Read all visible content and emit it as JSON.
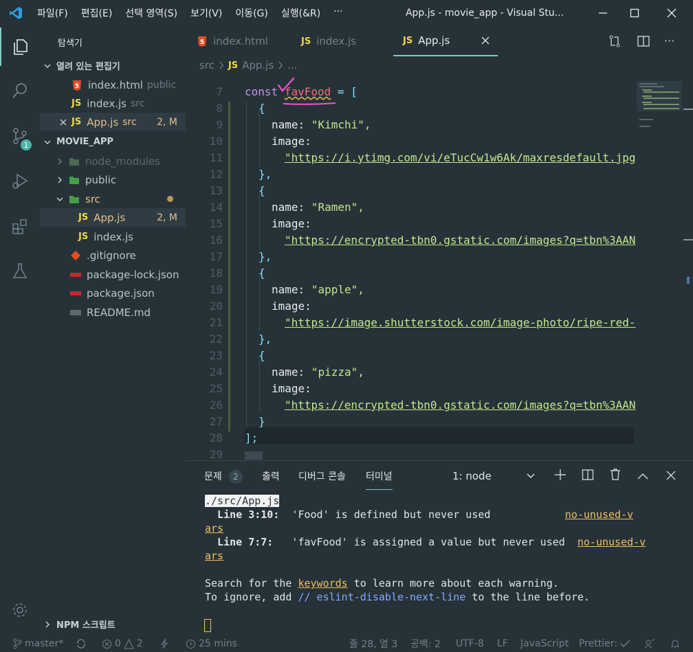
{
  "menu": {
    "items": [
      "파일(F)",
      "편집(E)",
      "선택 영역(S)",
      "보기(V)",
      "이동(G)",
      "실행(&R)",
      "···"
    ]
  },
  "window_title": "App.js - movie_app - Visual Stu...",
  "activity": {
    "scm_badge": "1"
  },
  "sidebar": {
    "title": "탐색기",
    "open_editors": {
      "title": "열려 있는 편집기",
      "files": [
        {
          "name": "index.html",
          "folder": "public"
        },
        {
          "name": "index.js",
          "folder": "src"
        },
        {
          "name": "App.js",
          "folder": "src",
          "status": "2, M"
        }
      ]
    },
    "project": {
      "title": "MOVIE_APP",
      "items": [
        {
          "name": "node_modules"
        },
        {
          "name": "public"
        },
        {
          "name": "src"
        },
        {
          "name": "App.js",
          "status": "2, M"
        },
        {
          "name": "index.js"
        },
        {
          "name": ".gitignore"
        },
        {
          "name": "package-lock.json"
        },
        {
          "name": "package.json"
        },
        {
          "name": "README.md"
        }
      ]
    },
    "npm_title": "NPM 스크립트"
  },
  "tabs": [
    {
      "label": "index.html"
    },
    {
      "label": "index.js"
    },
    {
      "label": "App.js"
    }
  ],
  "breadcrumb": {
    "folder": "src",
    "file": "App.js",
    "more": "..."
  },
  "editor": {
    "lines": [
      {
        "n": "7"
      },
      {
        "n": "8"
      },
      {
        "n": "9"
      },
      {
        "n": "10"
      },
      {
        "n": "11"
      },
      {
        "n": "12"
      },
      {
        "n": "13"
      },
      {
        "n": "14"
      },
      {
        "n": "15"
      },
      {
        "n": "16"
      },
      {
        "n": "17"
      },
      {
        "n": "18"
      },
      {
        "n": "19"
      },
      {
        "n": "20"
      },
      {
        "n": "21"
      },
      {
        "n": "22"
      },
      {
        "n": "23"
      },
      {
        "n": "24"
      },
      {
        "n": "25"
      },
      {
        "n": "26"
      },
      {
        "n": "27"
      },
      {
        "n": "28"
      },
      {
        "n": "29"
      }
    ],
    "code": {
      "l7_kw": "const",
      "l7_var": "favFood",
      "l7_rest": " = [",
      "open": "{",
      "close": "},",
      "close_last": "}",
      "end": "];",
      "name_key": "name:",
      "image_key": "image:",
      "names": [
        "\"Kimchi\",",
        "\"Ramen\",",
        "\"apple\",",
        "\"pizza\","
      ],
      "urls": [
        "\"https://i.ytimg.com/vi/eTucCw1w6Ak/maxresdefault.jpg",
        "\"https://encrypted-tbn0.gstatic.com/images?q=tbn%3AAN",
        "\"https://image.shutterstock.com/image-photo/ripe-red-",
        "\"https://encrypted-tbn0.gstatic.com/images?q=tbn%3AAN"
      ]
    }
  },
  "panel": {
    "tabs": {
      "problems": "문제",
      "problems_count": "2",
      "output": "출력",
      "debug": "디버그 콘솔",
      "terminal": "터미널"
    },
    "terminal_select": "1: node",
    "terminal": {
      "file": "./src/App.js",
      "w1_loc": "  Line 3:10:",
      "w1_msg": "  'Food' is defined but never used            ",
      "w1_rule_a": "no-unused-v",
      "w1_rule_b": "ars",
      "w2_loc": "  Line 7:7:",
      "w2_msg": "   'favFood' is assigned a value but never used  ",
      "w2_rule_a": "no-unused-v",
      "w2_rule_b": "ars",
      "search_a": "Search for the ",
      "search_kw": "keywords",
      "search_b": " to learn more about each warning.",
      "ignore_a": "To ignore, add ",
      "ignore_cmt": "// eslint-disable-next-line",
      "ignore_b": " to the line before."
    }
  },
  "status": {
    "branch": "master*",
    "errors": "0",
    "warnings": "2",
    "time": "25 mins",
    "position": "줄 28, 열 3",
    "spaces": "공백: 2",
    "encoding": "UTF-8",
    "eol": "LF",
    "language": "JavaScript",
    "prettier": "Prettier:"
  },
  "colors": {
    "accent": "#80cbc4",
    "background": "#263238",
    "js_yellow": "#f0d84a",
    "string": "#c3e88d",
    "keyword": "#c792ea",
    "modified": "#e2c08d"
  }
}
